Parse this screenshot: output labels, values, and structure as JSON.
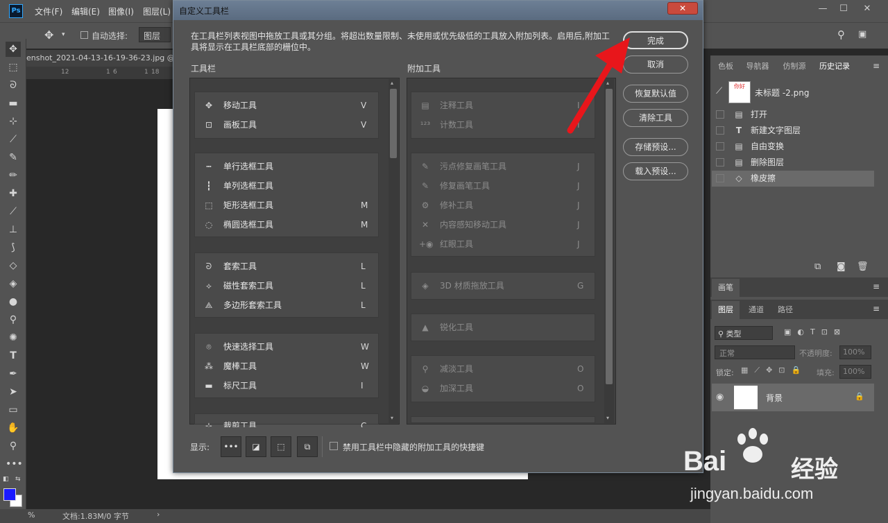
{
  "app": {
    "logo": "Ps"
  },
  "menu": [
    "文件(F)",
    "编辑(E)",
    "图像(I)",
    "图层(L)"
  ],
  "window_controls": {
    "minimize": "—",
    "maximize": "☐",
    "close": "✕"
  },
  "options_bar": {
    "auto_select_label": "自动选择:",
    "auto_select_value": "图层"
  },
  "document": {
    "tab_title": "enshot_2021-04-13-16-19-36-23.jpg @",
    "ruler_ticks": [
      "12",
      "1",
      "6",
      "1",
      "18"
    ]
  },
  "status": {
    "zoom": "%",
    "doc_info": "文档:1.83M/0 字节"
  },
  "right_panel": {
    "tabs": [
      "色板",
      "导航器",
      "仿制源",
      "历史记录"
    ],
    "history_snapshot": "未标题 -2.png",
    "snapshot_thumb_text": "你好",
    "history": [
      {
        "icon": "doc",
        "label": "打开"
      },
      {
        "icon": "text",
        "label": "新建文字图层"
      },
      {
        "icon": "doc",
        "label": "自由变换"
      },
      {
        "icon": "doc",
        "label": "删除图层"
      },
      {
        "icon": "eraser",
        "label": "橡皮擦"
      }
    ],
    "brush_tab": "画笔",
    "layer_tabs": [
      "图层",
      "通道",
      "路径"
    ],
    "layer_filter": "类型",
    "blend_mode": "正常",
    "opacity_label": "不透明度:",
    "opacity_value": "100%",
    "lock_label": "锁定:",
    "fill_label": "填充:",
    "fill_value": "100%",
    "layer_name": "背景"
  },
  "dialog": {
    "title": "自定义工具栏",
    "description": "在工具栏列表视图中拖放工具或其分组。将超出数量限制、未使用或优先级低的工具放入附加列表。启用后,附加工具将显示在工具栏底部的栅位中。",
    "toolbar_heading": "工具栏",
    "extra_heading": "附加工具",
    "toolbar_groups": [
      [
        {
          "icon": "✥",
          "name": "移动工具",
          "key": "V"
        },
        {
          "icon": "⊡",
          "name": "画板工具",
          "key": "V"
        }
      ],
      [
        {
          "icon": "┅",
          "name": "单行选框工具",
          "key": ""
        },
        {
          "icon": "┇",
          "name": "单列选框工具",
          "key": ""
        },
        {
          "icon": "⬚",
          "name": "矩形选框工具",
          "key": "M"
        },
        {
          "icon": "◌",
          "name": "椭圆选框工具",
          "key": "M"
        }
      ],
      [
        {
          "icon": "ᘐ",
          "name": "套索工具",
          "key": "L"
        },
        {
          "icon": "⟡",
          "name": "磁性套索工具",
          "key": "L"
        },
        {
          "icon": "⟁",
          "name": "多边形套索工具",
          "key": "L"
        }
      ],
      [
        {
          "icon": "⌾",
          "name": "快速选择工具",
          "key": "W"
        },
        {
          "icon": "⁂",
          "name": "魔棒工具",
          "key": "W"
        },
        {
          "icon": "▬",
          "name": "标尺工具",
          "key": "I"
        }
      ],
      [
        {
          "icon": "⊹",
          "name": "裁剪工具",
          "key": "C"
        }
      ]
    ],
    "extra_groups": [
      [
        {
          "icon": "▤",
          "name": "注释工具",
          "key": "I"
        },
        {
          "icon": "¹²³",
          "name": "计数工具",
          "key": "I"
        }
      ],
      [
        {
          "icon": "✎",
          "name": "污点修复画笔工具",
          "key": "J"
        },
        {
          "icon": "✎",
          "name": "修复画笔工具",
          "key": "J"
        },
        {
          "icon": "⚙",
          "name": "修补工具",
          "key": "J"
        },
        {
          "icon": "✕",
          "name": "内容感知移动工具",
          "key": "J"
        },
        {
          "icon": "+◉",
          "name": "红眼工具",
          "key": "J"
        }
      ],
      [
        {
          "icon": "◈",
          "name": "3D 材质拖放工具",
          "key": "G"
        }
      ],
      [
        {
          "icon": "▲",
          "name": "锐化工具",
          "key": ""
        }
      ],
      [
        {
          "icon": "⚲",
          "name": "减淡工具",
          "key": "O"
        },
        {
          "icon": "◒",
          "name": "加深工具",
          "key": "O"
        }
      ]
    ],
    "buttons": {
      "done": "完成",
      "cancel": "取消",
      "restore": "恢复默认值",
      "clear": "清除工具",
      "save_preset": "存储预设...",
      "load_preset": "载入预设..."
    },
    "footer_label": "显示:",
    "footer_buttons": [
      "•••",
      "◪",
      "⬚",
      "⧉"
    ],
    "footer_checkbox_label": "禁用工具栏中隐藏的附加工具的快捷键"
  },
  "watermark": {
    "brand": "Bai",
    "brand2": "经验",
    "url": "jingyan.baidu.com"
  },
  "colors": {
    "accent": "#31a8ff",
    "arrow": "#e8161b",
    "fg_swatch": "#1a1aff",
    "bg_swatch": "#ffffff"
  }
}
